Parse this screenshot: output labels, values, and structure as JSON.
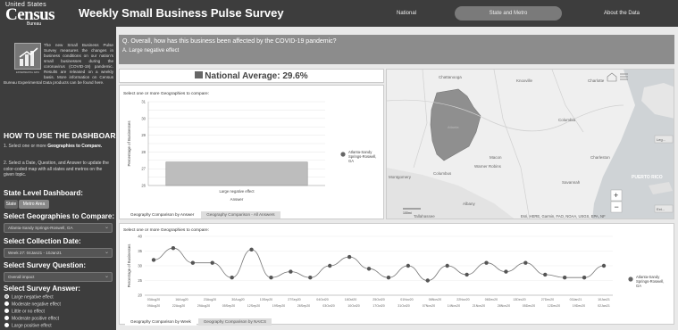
{
  "header": {
    "logo_top": "United States",
    "logo_main": "Census",
    "logo_bottom": "Bureau",
    "title": "Weekly Small Business Pulse Survey",
    "nav": [
      "National",
      "State and Metro",
      "About the Data"
    ]
  },
  "sidebar": {
    "intro_icon_label": "EXPERIMENTAL DATA",
    "intro": "The new Small Business Pulse Survey measures the changes in business conditions on our nation's small businesses during the coronavirus (COVID-19) pandemic. Results are released on a weekly basis. More information on Census Bureau Experimental Data products can be found here.",
    "howto_heading": "HOW TO USE THE DASHBOARD",
    "step1_pre": "1. Select one or more ",
    "step1_bold": "Geographies to Compare.",
    "step2": "2. Select a Date, Question, and Answer to update the color-coded map with all states and metros on the given topic.",
    "level_heading": "State Level Dashboard:",
    "level_buttons": [
      "State",
      "Metro Area"
    ],
    "geo_heading": "Select Geographies to Compare:",
    "geo_value": "Atlanta-Sandy Springs-Roswell, GA",
    "date_heading": "Select Collection Date:",
    "date_value": "Week 27: 04Jan21 - 10Jan21",
    "question_heading": "Select Survey Question:",
    "question_value": "Overall impact",
    "answer_heading": "Select Survey Answer:",
    "answers": [
      "Large negative effect",
      "Moderate negative effect",
      "Little or no effect",
      "Moderate positive effect",
      "Large positive effect"
    ]
  },
  "question": {
    "text": "Q. Overall, how has this business been affected by the COVID-19 pandemic?",
    "answer": "A. Large negative effect"
  },
  "national_average": "National Average: 29.6%",
  "top_panel": {
    "prompt": "Select one or more Geographies to compare:",
    "tabs": [
      "Geography Comparison by Answer",
      "Geography Comparison - All Answers"
    ]
  },
  "map": {
    "labels": [
      "Chattanooga",
      "Knoxville",
      "Charlotte",
      "Columbia",
      "Macon",
      "Warner Robins",
      "Columbus",
      "Montgomery",
      "Albany",
      "Savannah",
      "Charleston",
      "Tallahassee",
      "Atlanta",
      "PUERTO RICO"
    ],
    "attribution": "Esri, HERE, Garmin, FAO, NOAA, USGS, EPA, NF",
    "legend_btn": "Leg...",
    "ext_btn": "Ext...",
    "scale": "100mi"
  },
  "bottom_panel": {
    "prompt": "Select one or more Geographies to compare:",
    "tabs": [
      "Geography Comparison by Week",
      "Geography Comparison by NAICS"
    ]
  },
  "chart_data": [
    {
      "type": "bar",
      "categories": [
        "Large negative effect"
      ],
      "series": [
        {
          "name": "Atlanta-Sandy Springs-Roswell, GA",
          "values": [
            27.4
          ]
        }
      ],
      "xlabel": "Answer",
      "ylabel": "Percentage of Businesses",
      "yticks": [
        26,
        26.5,
        27,
        27.5,
        28,
        28.5,
        29,
        29.5,
        30,
        30.5,
        31
      ],
      "ylim": [
        26,
        31
      ],
      "color": "#bdbdbd",
      "legend": "right"
    },
    {
      "type": "line",
      "x": [
        "04Aug20",
        "16Aug20",
        "22Aug20",
        "30Aug20",
        "05Sep20",
        "13Sep20",
        "19Sep20",
        "27Sep20",
        "03Oct20",
        "11Oct20",
        "17Oct20",
        "25Oct20",
        "31Oct20",
        "08Nov20",
        "14Nov20",
        "22Nov20",
        "28Nov20",
        "06Dec20",
        "12Dec20",
        "20Dec20",
        "26Dec20",
        "03Jan21",
        "04Jan21",
        "10Jan21"
      ],
      "x_ticks_top": [
        "03Aug20",
        "16Aug20",
        "23Aug20",
        "30Aug20",
        "13Sep20",
        "27Sep20",
        "04Oct20",
        "18Oct20",
        "25Oct20",
        "01Nov20",
        "08Nov20",
        "22Nov20",
        "06Dec20",
        "13Dec20",
        "27Dec20",
        "03Jan21",
        "10Jan21"
      ],
      "x_ticks_bottom": [
        "09Aug20",
        "22Aug20",
        "29Aug20",
        "05Sep20",
        "12Sep20",
        "19Sep20",
        "26Sep20",
        "03Oct20",
        "10Oct20",
        "17Oct20",
        "31Oct20",
        "07Nov20",
        "14Nov20",
        "21Nov20",
        "28Nov20",
        "05Dec20",
        "12Dec20",
        "19Dec20",
        "02Jan21"
      ],
      "series": [
        {
          "name": "Atlanta-Sandy Springs-Roswell, GA",
          "values": [
            32,
            36,
            31,
            31,
            26,
            35.5,
            26,
            28,
            26,
            30,
            33,
            29,
            26,
            30,
            25,
            30,
            27,
            31,
            28,
            31,
            27,
            26,
            26,
            30
          ]
        }
      ],
      "ylabel": "Percentage of Businesses",
      "yticks": [
        20,
        25,
        30,
        35,
        40
      ],
      "ylim": [
        20,
        40
      ],
      "color": "#555555",
      "legend": "right"
    }
  ]
}
